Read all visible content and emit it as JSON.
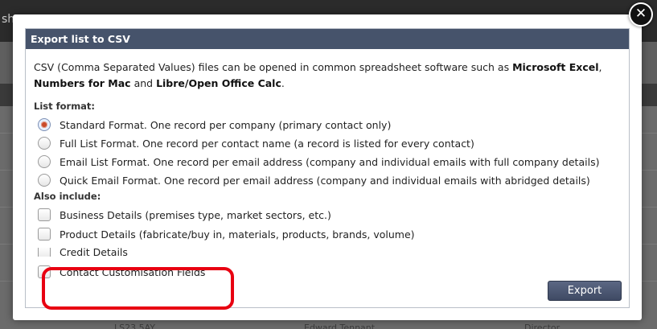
{
  "background": {
    "topbar_text": "sh",
    "footer_cells": [
      "LS23 5AY",
      "Edward Tennant",
      "Director"
    ]
  },
  "dialog": {
    "title": "Export list to CSV",
    "description": {
      "part1": "CSV (Comma Separated Values) files can be opened in common spreadsheet software such as ",
      "bold1": "Microsoft Excel",
      "part2": ", ",
      "bold2": "Numbers for Mac",
      "part3": " and ",
      "bold3": "Libre/Open Office Calc",
      "part4": "."
    },
    "list_format_label": "List format:",
    "list_formats": [
      {
        "label": "Standard Format. One record per company (primary contact only)",
        "checked": true
      },
      {
        "label": "Full List Format. One record per contact name (a record is listed for every contact)",
        "checked": false
      },
      {
        "label": "Email List Format. One record per email address (company and individual emails with full company details)",
        "checked": false
      },
      {
        "label": "Quick Email Format. One record per email address (company and individual emails with abridged details)",
        "checked": false
      }
    ],
    "also_include_label": "Also include:",
    "also_include": [
      {
        "label": "Business Details (premises type, market sectors, etc.)",
        "checked": false
      },
      {
        "label": "Product Details (fabricate/buy in, materials, products, brands, volume)",
        "checked": false
      },
      {
        "label": "Credit Details",
        "checked": false
      },
      {
        "label": "Contact Customisation Fields",
        "checked": false
      }
    ],
    "export_button": "Export",
    "close_glyph": "✕"
  },
  "colors": {
    "title_bar": "#46536b",
    "highlight": "#e80011",
    "radio_selected": "#c94a2a"
  }
}
